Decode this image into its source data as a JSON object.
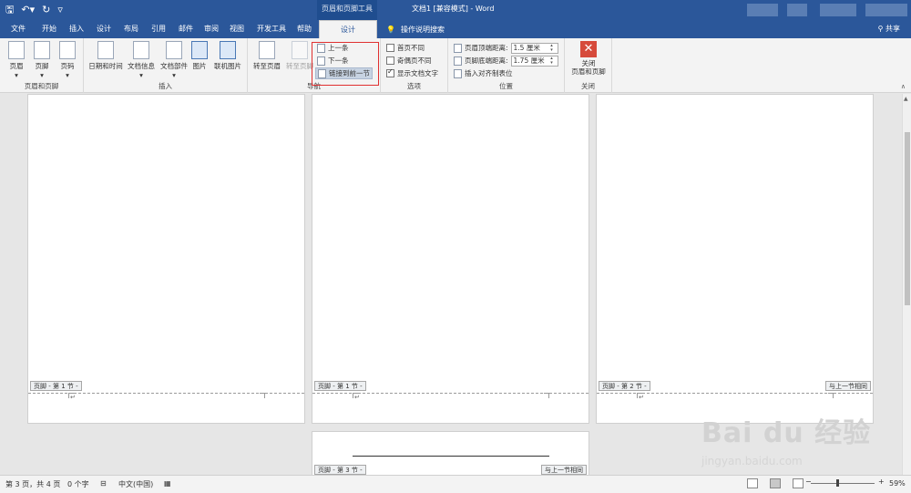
{
  "titlebar": {
    "qat": [
      "save-icon",
      "undo-icon",
      "redo-icon",
      "customize-icon"
    ],
    "context_tool": "页眉和页脚工具",
    "doc_title": "文档1 [兼容模式]  -  Word"
  },
  "tabs": {
    "items": [
      "文件",
      "开始",
      "插入",
      "设计",
      "布局",
      "引用",
      "邮件",
      "审阅",
      "视图",
      "开发工具",
      "帮助",
      "设计"
    ],
    "active_index": 11,
    "tell_me": "操作说明搜索",
    "share": "共享"
  },
  "ribbon": {
    "groups": {
      "header_footer": {
        "label": "页眉和页脚",
        "buttons": [
          "页眉",
          "页脚",
          "页码"
        ]
      },
      "insert": {
        "label": "插入",
        "buttons": [
          "日期和时间",
          "文档信息",
          "文档部件",
          "图片",
          "联机图片"
        ]
      },
      "navigation": {
        "label": "导航",
        "goto_header": "转至页眉",
        "goto_footer": "转至页脚",
        "prev": "上一条",
        "next": "下一条",
        "link_prev": "链接到前一节"
      },
      "options": {
        "label": "选项",
        "items": [
          {
            "label": "首页不同",
            "checked": false
          },
          {
            "label": "奇偶页不同",
            "checked": false
          },
          {
            "label": "显示文档文字",
            "checked": true
          }
        ]
      },
      "position": {
        "label": "位置",
        "header_dist_label": "页眉顶端距离:",
        "header_dist_value": "1.5 厘米",
        "footer_dist_label": "页脚底端距离:",
        "footer_dist_value": "1.75 厘米",
        "insert_tab": "插入对齐制表位"
      },
      "close": {
        "label": "关闭",
        "button": "关闭\n页眉和页脚"
      }
    }
  },
  "document": {
    "pages": [
      {
        "footer_tag": "页脚 - 第 1 节 -",
        "same_as_prev": ""
      },
      {
        "footer_tag": "页脚 - 第 1 节 -",
        "same_as_prev": ""
      },
      {
        "footer_tag": "页脚 - 第 2 节 -",
        "same_as_prev": "与上一节相同"
      },
      {
        "footer_tag": "页脚 - 第 3 节 -",
        "same_as_prev": "与上一节相同"
      }
    ],
    "para_mark": "↵"
  },
  "watermark": {
    "logo": "Bai du 经验",
    "url": "jingyan.baidu.com"
  },
  "status": {
    "page": "第 3 页，共 4 页",
    "words": "0 个字",
    "language": "中文(中国)",
    "zoom": "59%",
    "zoom_minus": "−",
    "zoom_plus": "+"
  },
  "colors": {
    "accent": "#2b579a",
    "highlight_box": "#e03030"
  }
}
